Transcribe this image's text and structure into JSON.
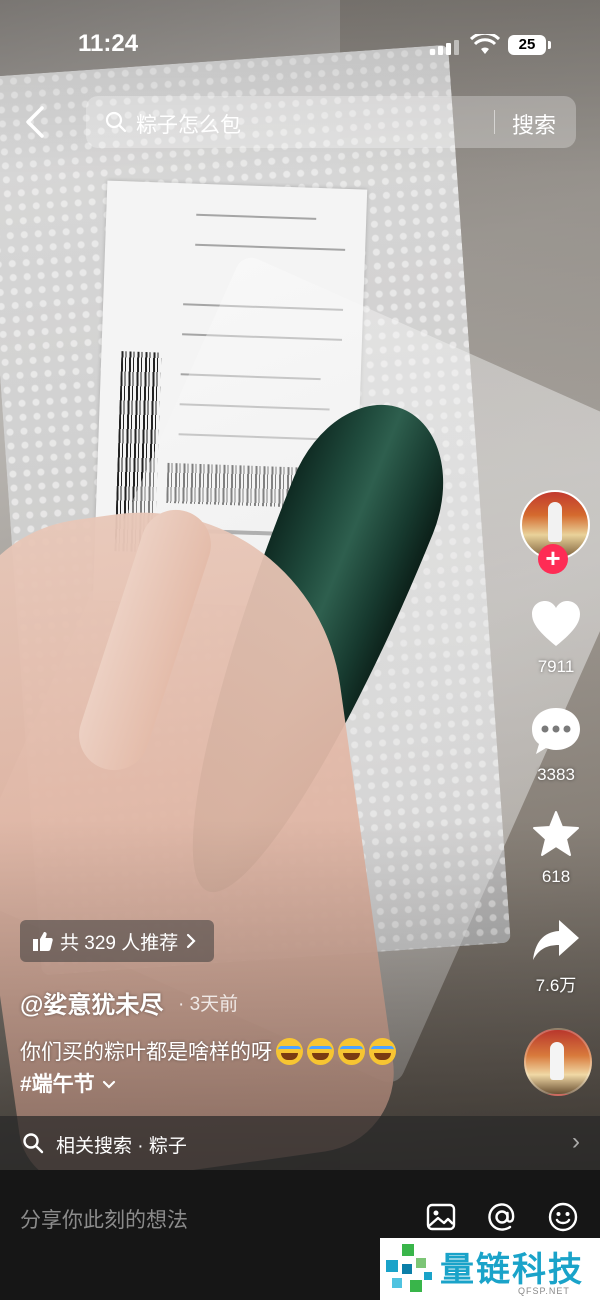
{
  "status_bar": {
    "time": "11:24",
    "battery": "25"
  },
  "search": {
    "placeholder": "粽子怎么包",
    "button_label": "搜索"
  },
  "actions": {
    "like_count": "7911",
    "comment_count": "3383",
    "favorite_count": "618",
    "share_count": "7.6万"
  },
  "recommend": {
    "label": "共 329 人推荐"
  },
  "video": {
    "author": "@娑意犹未尽",
    "time_ago": "· 3天前",
    "caption": "你们买的粽叶都是啥样的呀",
    "hashtag": "#端午节"
  },
  "related_search": {
    "label": "相关搜索 · 粽子"
  },
  "comment_bar": {
    "placeholder": "分享你此刻的想法"
  },
  "watermark": {
    "brand": "量链科技",
    "url": "QFSP.NET"
  },
  "colors": {
    "follow_accent": "#fe2c55",
    "watermark_blue": "#1aa3c9"
  },
  "icons": [
    "back-icon",
    "search-icon",
    "heart-icon",
    "comment-icon",
    "star-icon",
    "share-icon",
    "thumbs-up-icon",
    "image-icon",
    "at-icon",
    "emoji-icon"
  ]
}
